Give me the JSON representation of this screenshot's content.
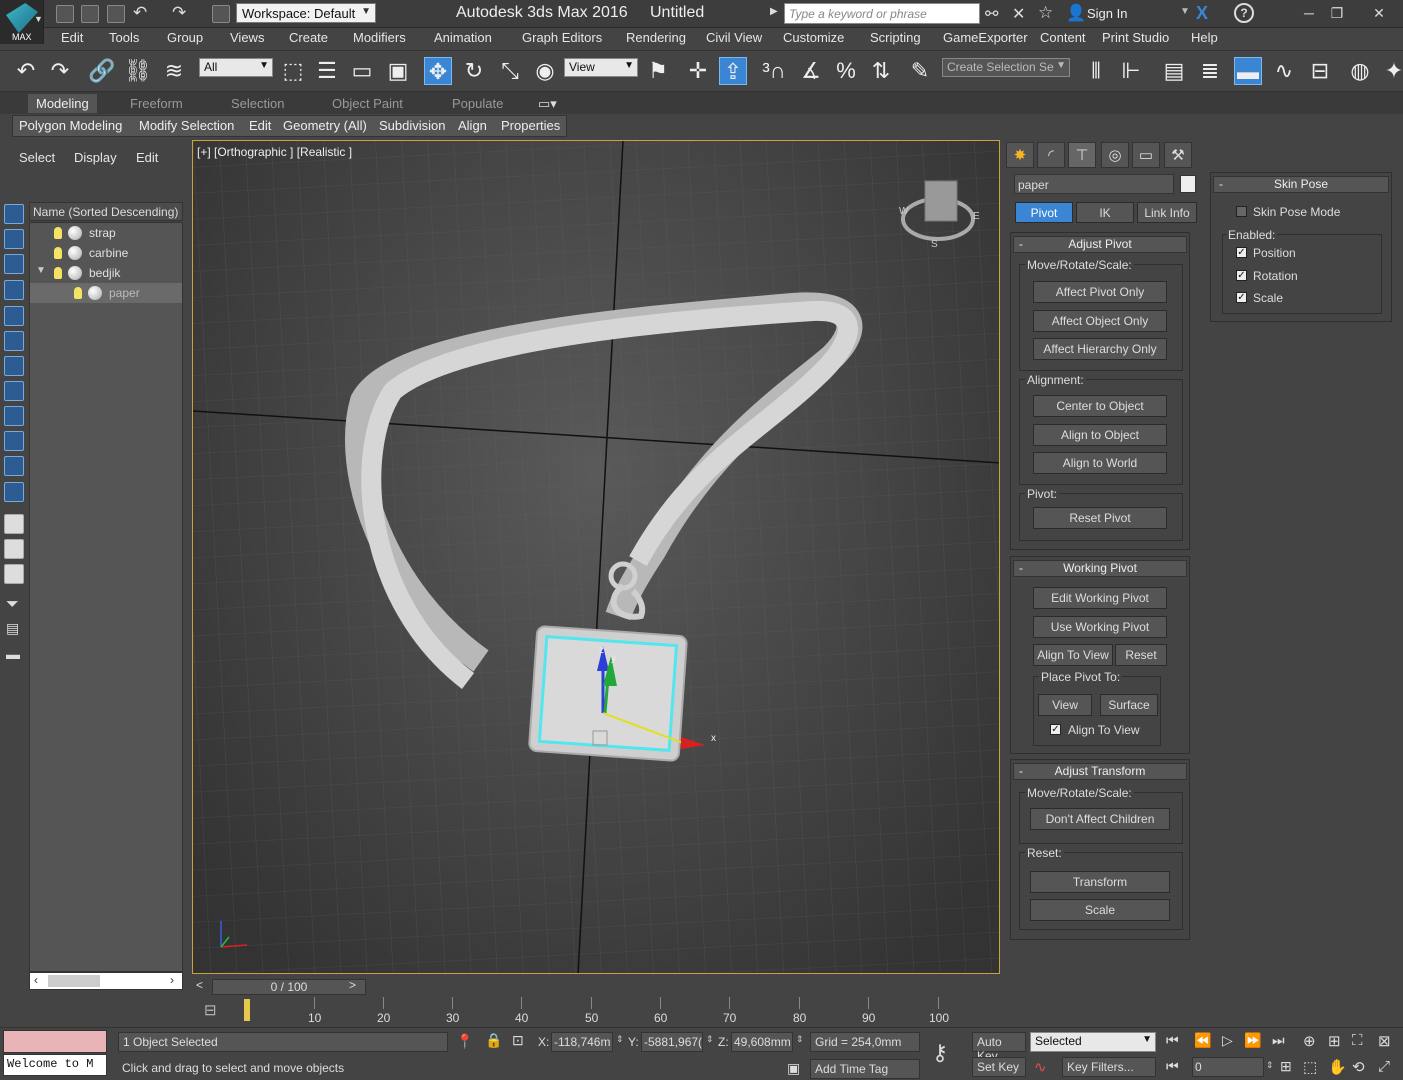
{
  "titlebar": {
    "logo": "MAX",
    "workspace": "Workspace: Default",
    "app_title": "Autodesk 3ds Max 2016",
    "doc_title": "Untitled",
    "search_placeholder": "Type a keyword or phrase",
    "sign_in": "Sign In"
  },
  "menu": [
    "Edit",
    "Tools",
    "Group",
    "Views",
    "Create",
    "Modifiers",
    "Animation",
    "Graph Editors",
    "Rendering",
    "Civil View",
    "Customize",
    "Scripting",
    "GameExporter",
    "Content",
    "Print Studio",
    "Help"
  ],
  "toolbar": {
    "filter": "All",
    "ref_coord": "View",
    "selection_set": "Create Selection Se"
  },
  "ribbon": {
    "tabs": [
      "Modeling",
      "Freeform",
      "Selection",
      "Object Paint",
      "Populate"
    ],
    "subtabs": [
      "Polygon Modeling",
      "Modify Selection",
      "Edit",
      "Geometry (All)",
      "Subdivision",
      "Align",
      "Properties"
    ]
  },
  "scene_explorer": {
    "tabs": [
      "Select",
      "Display",
      "Edit"
    ],
    "header": "Name (Sorted Descending)",
    "items": [
      "strap",
      "carbine",
      "bedjik",
      "paper"
    ],
    "selected": "paper"
  },
  "viewport": {
    "label": "[+] [Orthographic ] [Realistic ]",
    "gizmo_axes": [
      "x",
      "y",
      "z"
    ],
    "viewcube_labels": [
      "W",
      "E",
      "S"
    ]
  },
  "command_panel": {
    "object_name": "paper",
    "hierarchy_tabs": [
      "Pivot",
      "IK",
      "Link Info"
    ],
    "adjust_pivot": {
      "title": "Adjust Pivot",
      "move_group": "Move/Rotate/Scale:",
      "buttons": [
        "Affect Pivot Only",
        "Affect Object Only",
        "Affect Hierarchy Only"
      ],
      "align_group": "Alignment:",
      "align_buttons": [
        "Center to Object",
        "Align to Object",
        "Align to World"
      ],
      "pivot_group": "Pivot:",
      "reset": "Reset Pivot"
    },
    "working_pivot": {
      "title": "Working Pivot",
      "edit": "Edit Working Pivot",
      "use": "Use Working Pivot",
      "align_to_view": "Align To View",
      "reset": "Reset",
      "place_group": "Place Pivot To:",
      "view": "View",
      "surface": "Surface",
      "align_chk": "Align To View"
    },
    "adjust_transform": {
      "title": "Adjust Transform",
      "move_group": "Move/Rotate/Scale:",
      "dont_affect": "Don't Affect Children",
      "reset_group": "Reset:",
      "transform": "Transform",
      "scale": "Scale"
    },
    "skin_pose": {
      "title": "Skin Pose",
      "mode": "Skin Pose Mode",
      "enabled": "Enabled:",
      "position": "Position",
      "rotation": "Rotation",
      "scale": "Scale"
    }
  },
  "timeline": {
    "frame": "0 / 100",
    "ticks": [
      "10",
      "20",
      "30",
      "40",
      "50",
      "60",
      "70",
      "80",
      "90",
      "100"
    ]
  },
  "status": {
    "listener": "Welcome to M",
    "selected": "1 Object Selected",
    "prompt": "Click and drag to select and move objects",
    "x_label": "X:",
    "x": "-118,746m",
    "y_label": "Y:",
    "y": "-5881,967(",
    "z_label": "Z:",
    "z": "49,608mm",
    "grid": "Grid = 254,0mm",
    "add_time_tag": "Add Time Tag",
    "auto_key": "Auto Key",
    "set_key": "Set Key",
    "key_mode": "Selected",
    "key_filters": "Key Filters...",
    "frame_field": "0"
  }
}
